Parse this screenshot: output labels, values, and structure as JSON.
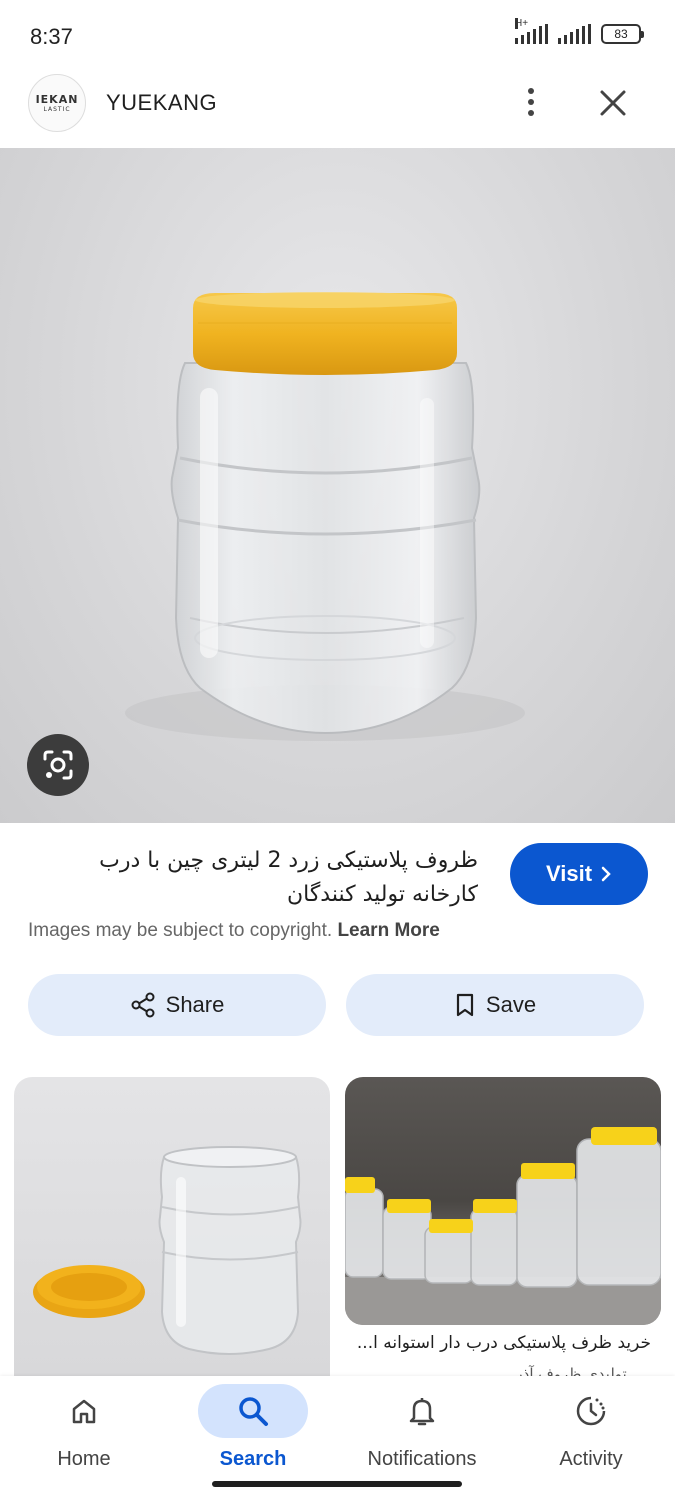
{
  "status_bar": {
    "time": "8:37",
    "network": "H+",
    "battery": "83"
  },
  "header": {
    "logo_line1": "IEKAN",
    "logo_line2": "LASTIC",
    "site_name": "YUEKANG",
    "more_icon": "more-vert-icon",
    "close_icon": "close-icon"
  },
  "result": {
    "title_line1": "ظروف پلاستیکی زرد 2 لیتری چین با درب",
    "title_line2": "کارخانه تولید کنندگان",
    "copyright": "Images may be subject to copyright.",
    "learn_more": "Learn More",
    "visit_label": "Visit",
    "share_label": "Share",
    "save_label": "Save"
  },
  "related": [
    {
      "caption": "",
      "source": ""
    },
    {
      "caption": "خرید ظرف پلاستیکی درب دار استوانه ا...",
      "source": "...تولیدی ظروف آذر"
    }
  ],
  "colors": {
    "accent": "#0b57d0",
    "chip_bg": "#e3ecfa",
    "lid_yellow": "#f2b21c"
  },
  "bottom_nav": {
    "items": [
      {
        "label": "Home",
        "icon": "home-icon"
      },
      {
        "label": "Search",
        "icon": "search-icon",
        "active": true
      },
      {
        "label": "Notifications",
        "icon": "bell-icon"
      },
      {
        "label": "Activity",
        "icon": "activity-icon"
      }
    ]
  }
}
